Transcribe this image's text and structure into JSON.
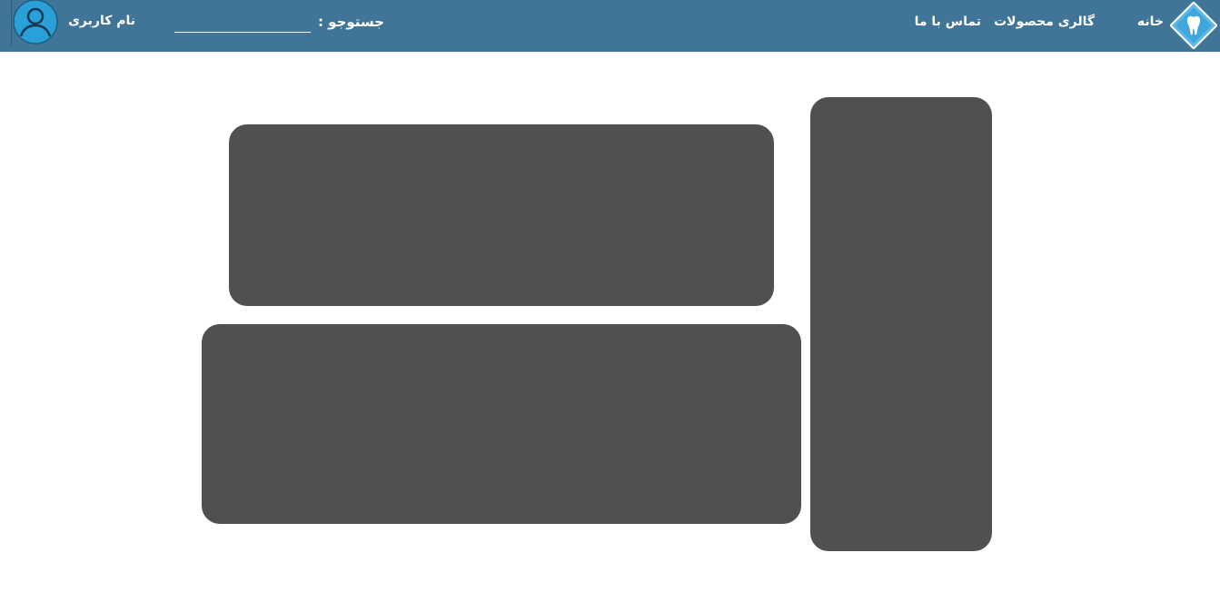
{
  "header": {
    "nav": {
      "home": "خانه",
      "gallery": "گالری محصولات",
      "contact": "تماس با ما"
    },
    "search": {
      "label": "جستوجو :",
      "value": ""
    },
    "user": {
      "name": "نام کاربری"
    },
    "logo_icon": "tooth-logo-icon",
    "avatar_icon": "user-avatar-icon"
  },
  "colors": {
    "header_background": "#417597",
    "panel": "#505050",
    "logo_blue": "#3fa7dc",
    "avatar_blue": "#2a9fd8"
  }
}
